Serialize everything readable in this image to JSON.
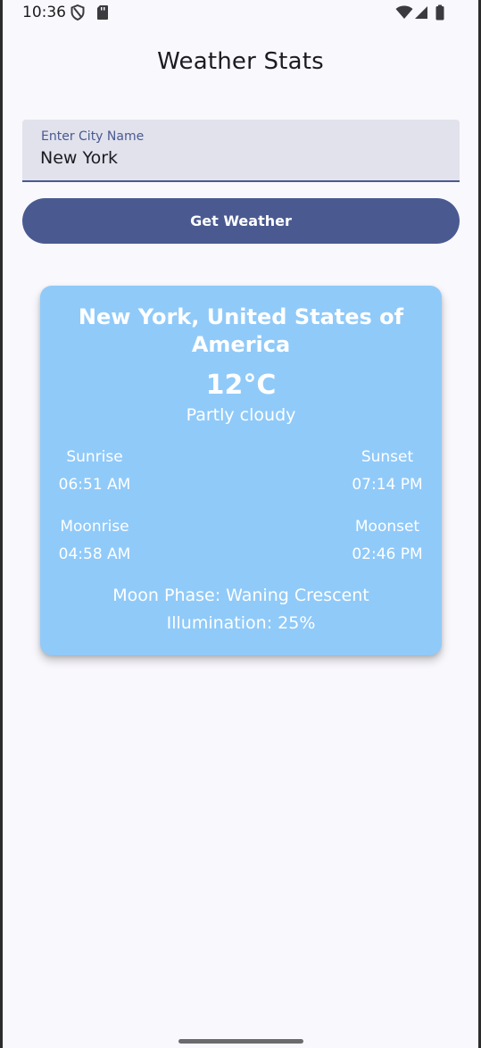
{
  "status_bar": {
    "time": "10:36",
    "icons": [
      "shield-icon",
      "sd-card-icon",
      "wifi-icon",
      "cellular-signal-icon",
      "battery-icon"
    ]
  },
  "app": {
    "title": "Weather Stats"
  },
  "search": {
    "label": "Enter City Name",
    "value": "New York"
  },
  "actions": {
    "get_weather_label": "Get Weather"
  },
  "weather": {
    "location": "New York, United States of America",
    "temperature": "12°C",
    "condition": "Partly cloudy",
    "sunrise_label": "Sunrise",
    "sunrise": "06:51 AM",
    "sunset_label": "Sunset",
    "sunset": "07:14 PM",
    "moonrise_label": "Moonrise",
    "moonrise": "04:58 AM",
    "moonset_label": "Moonset",
    "moonset": "02:46 PM",
    "moon_phase": "Moon Phase: Waning Crescent",
    "illumination": "Illumination: 25%"
  },
  "colors": {
    "background": "#f9f8fd",
    "accent": "#4a5a91",
    "field_background": "#e1e2ec",
    "card_background": "#90caf9",
    "card_text": "#ffffff"
  }
}
